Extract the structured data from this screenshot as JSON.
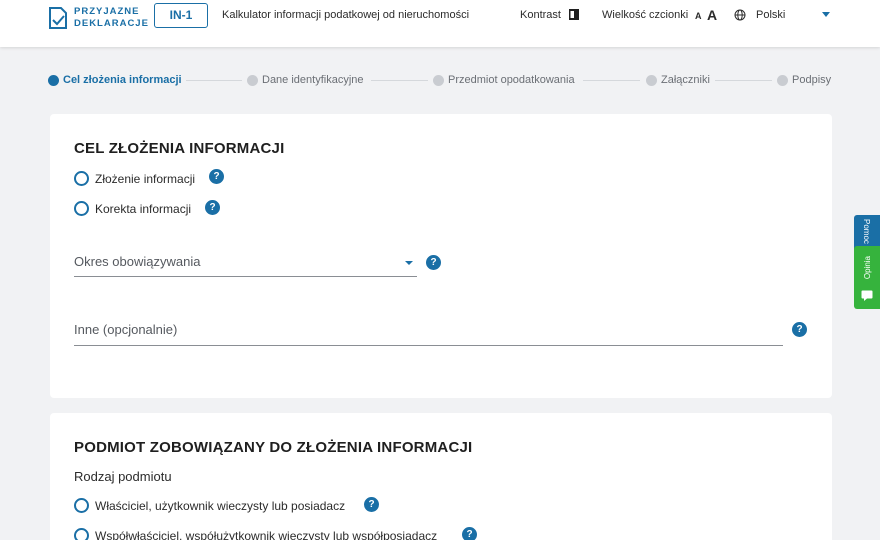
{
  "header": {
    "logo_line1": "PRZYJAZNE",
    "logo_line2": "DEKLARACJE",
    "form_code": "IN-1",
    "title": "Kalkulator informacji podatkowej od nieruchomości",
    "contrast_label": "Kontrast",
    "font_size_label": "Wielkość czcionki",
    "font_small": "A",
    "font_large": "A",
    "language": "Polski"
  },
  "stepper": {
    "steps": [
      {
        "label": "Cel złożenia informacji",
        "active": true
      },
      {
        "label": "Dane identyfikacyjne",
        "active": false
      },
      {
        "label": "Przedmiot opodatkowania",
        "active": false
      },
      {
        "label": "Załączniki",
        "active": false
      },
      {
        "label": "Podpisy",
        "active": false
      }
    ]
  },
  "purpose": {
    "title": "CEL ZŁOŻENIA INFORMACJI",
    "options": [
      "Złożenie informacji",
      "Korekta informacji"
    ],
    "period_placeholder": "Okres obowiązywania",
    "other_placeholder": "Inne (opcjonalnie)"
  },
  "subject": {
    "title": "PODMIOT ZOBOWIĄZANY DO ZŁOŻENIA INFORMACJI",
    "type_label": "Rodzaj podmiotu",
    "options": [
      "Właściciel, użytkownik wieczysty lub posiadacz",
      "Współwłaściciel, współużytkownik wieczysty lub współposiadacz"
    ]
  },
  "side": {
    "help_label": "Pomoc",
    "opinion_label": "Opinia"
  },
  "help_symbol": "?",
  "colors": {
    "accent": "#1a6fa6",
    "opinion": "#36b33d",
    "background": "#f1f2f4"
  },
  "icons": {
    "logo": "document-check-icon",
    "contrast": "contrast-icon",
    "language": "globe-icon",
    "dropdown": "chevron-down-icon",
    "help": "question-circle-icon",
    "opinion": "chat-icon"
  }
}
